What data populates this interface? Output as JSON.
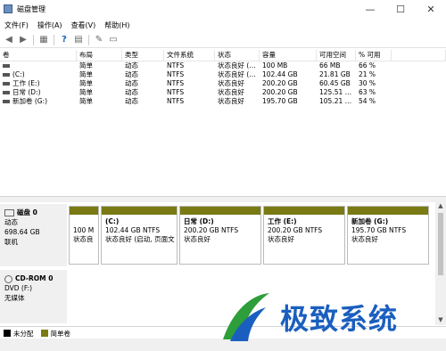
{
  "window": {
    "title": "磁盘管理",
    "controls": [
      "—",
      "☐",
      "✕"
    ]
  },
  "menu": [
    "文件(F)",
    "操作(A)",
    "查看(V)",
    "帮助(H)"
  ],
  "toolbar_icons": [
    "back-arrow-icon",
    "forward-arrow-icon",
    "properties-icon",
    "help-icon",
    "connect-icon",
    "disk-view-icon"
  ],
  "table": {
    "headers": [
      "卷",
      "布局",
      "类型",
      "文件系统",
      "状态",
      "容量",
      "可用空间",
      "% 可用"
    ],
    "rows": [
      [
        "",
        "简单",
        "动态",
        "NTFS",
        "状态良好 (…",
        "100 MB",
        "66 MB",
        "66 %"
      ],
      [
        "(C:)",
        "简单",
        "动态",
        "NTFS",
        "状态良好 (…",
        "102.44 GB",
        "21.81 GB",
        "21 %"
      ],
      [
        "工作 (E:)",
        "简单",
        "动态",
        "NTFS",
        "状态良好",
        "200.20 GB",
        "60.45 GB",
        "30 %"
      ],
      [
        "日常 (D:)",
        "简单",
        "动态",
        "NTFS",
        "状态良好",
        "200.20 GB",
        "125.51 …",
        "63 %"
      ],
      [
        "新加卷 (G:)",
        "简单",
        "动态",
        "NTFS",
        "状态良好",
        "195.70 GB",
        "105.21 …",
        "54 %"
      ]
    ]
  },
  "disk0": {
    "title": "磁盘 0",
    "lines": [
      "动态",
      "698.64 GB",
      "联机"
    ],
    "partitions": [
      {
        "name": "",
        "lines": [
          "100 M",
          "状态良"
        ]
      },
      {
        "name": "(C:)",
        "lines": [
          "102.44 GB NTFS",
          "状态良好 (启动, 页面文"
        ]
      },
      {
        "name": "日常  (D:)",
        "lines": [
          "200.20 GB NTFS",
          "状态良好"
        ]
      },
      {
        "name": "工作  (E:)",
        "lines": [
          "200.20 GB NTFS",
          "状态良好"
        ]
      },
      {
        "name": "新加卷  (G:)",
        "lines": [
          "195.70 GB NTFS",
          "状态良好"
        ]
      }
    ]
  },
  "cdrom": {
    "title": "CD-ROM 0",
    "lines": [
      "DVD (F:)",
      "",
      "无媒体"
    ]
  },
  "legend": [
    {
      "label": "未分配",
      "color": "#000000"
    },
    {
      "label": "简单卷",
      "color": "#7a7a14"
    }
  ],
  "watermark": {
    "text": "极致系统"
  }
}
